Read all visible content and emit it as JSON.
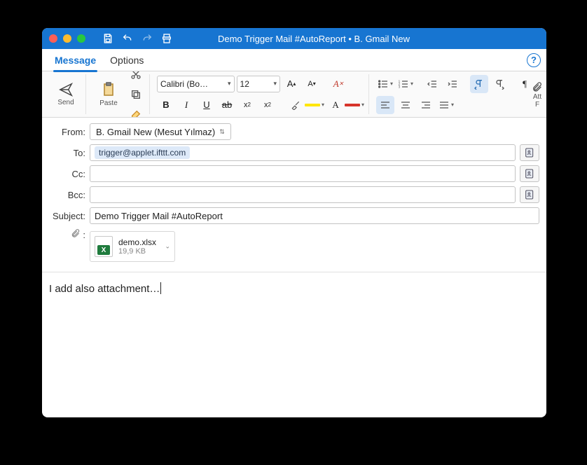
{
  "window": {
    "title": "Demo Trigger Mail #AutoReport • B. Gmail New"
  },
  "tabs": {
    "message": "Message",
    "options": "Options"
  },
  "ribbon": {
    "send": "Send",
    "paste": "Paste",
    "font_name": "Calibri (Bo…",
    "font_size": "12",
    "attach_partial": "Att",
    "attach_partial2": "F"
  },
  "fields": {
    "from_label": "From:",
    "from_value": "B. Gmail New (Mesut Yılmaz)",
    "to_label": "To:",
    "to_chip": "trigger@applet.ifttt.com",
    "cc_label": "Cc:",
    "bcc_label": "Bcc:",
    "subject_label": "Subject:",
    "subject_value": "Demo Trigger Mail #AutoReport"
  },
  "attachment": {
    "name": "demo.xlsx",
    "size": "19,9 KB"
  },
  "body": {
    "text": "I add also attachment…"
  }
}
